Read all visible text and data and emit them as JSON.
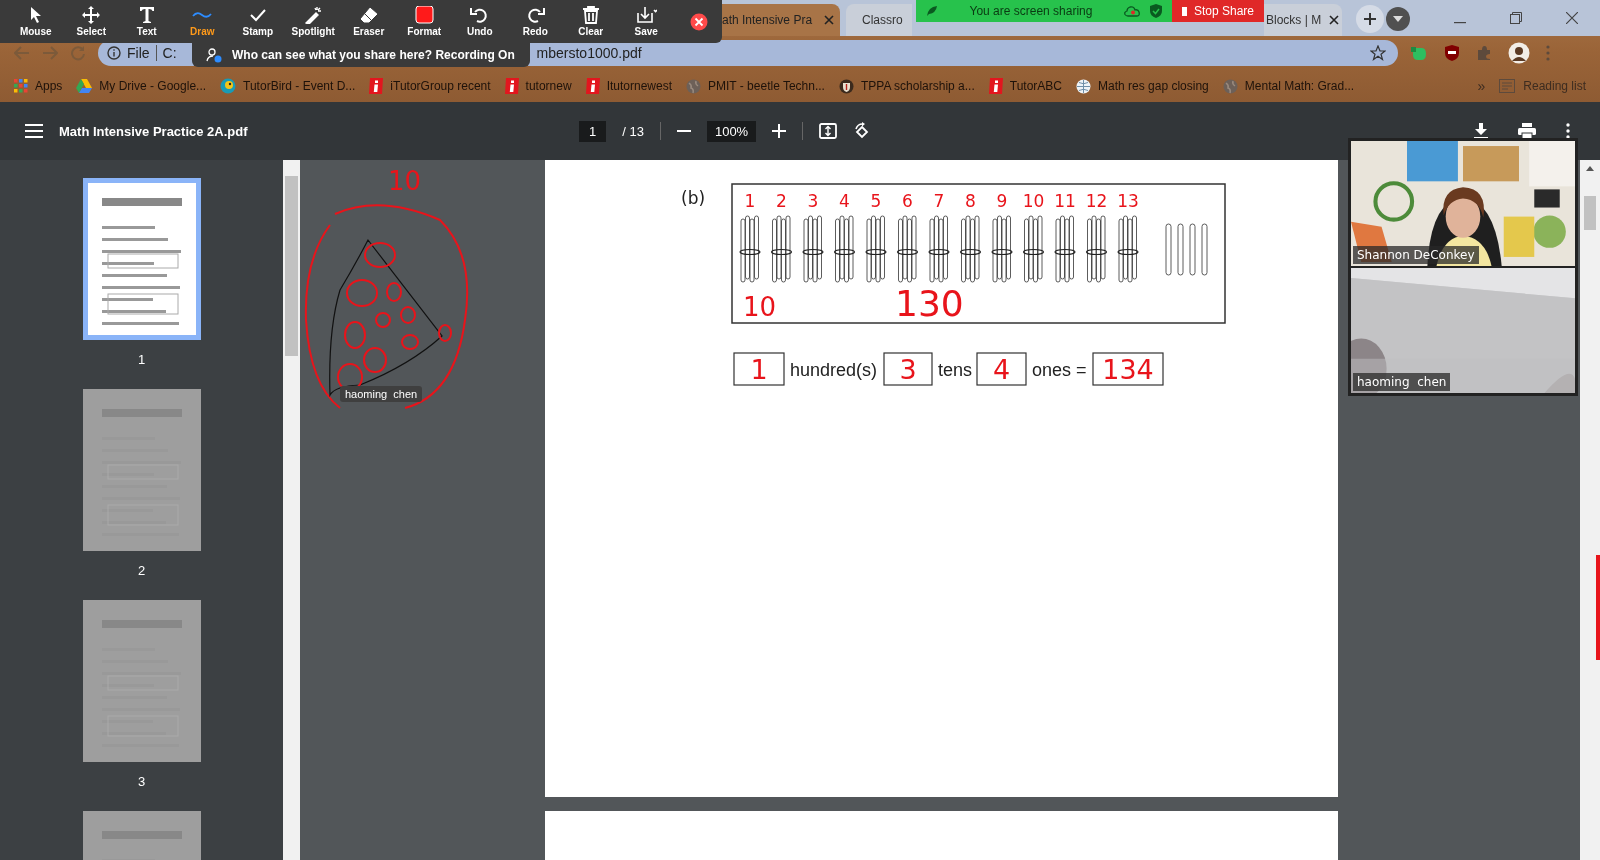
{
  "zoom_toolbar": {
    "tools": [
      {
        "label": "Mouse",
        "kind": "mouse",
        "selected": false
      },
      {
        "label": "Select",
        "kind": "select",
        "selected": false
      },
      {
        "label": "Text",
        "kind": "text",
        "selected": false
      },
      {
        "label": "Draw",
        "kind": "draw",
        "selected": true
      },
      {
        "label": "Stamp",
        "kind": "stamp",
        "selected": false
      },
      {
        "label": "Spotlight",
        "kind": "spotlight",
        "selected": false
      },
      {
        "label": "Eraser",
        "kind": "eraser",
        "selected": false
      },
      {
        "label": "Format",
        "kind": "format",
        "selected": false
      },
      {
        "label": "Undo",
        "kind": "undo",
        "selected": false
      },
      {
        "label": "Redo",
        "kind": "redo",
        "selected": false
      },
      {
        "label": "Clear",
        "kind": "clear",
        "selected": false
      },
      {
        "label": "Save",
        "kind": "save",
        "selected": false
      }
    ]
  },
  "share_tooltip": "Who can see what you share here? Recording On",
  "sharing_banner": {
    "text": "You are screen sharing",
    "stop_button": "Stop Share"
  },
  "browser": {
    "tabs": [
      {
        "title": "ath Intensive Pra",
        "selected": true,
        "closable": true
      },
      {
        "title": "Classro",
        "selected": false,
        "closable": false
      },
      {
        "title": "Blocks | M",
        "selected": false,
        "closable": true
      }
    ],
    "address": {
      "scheme": "File",
      "path_start": "C:",
      "path_end": "mbersto1000.pdf"
    },
    "bookmarks": [
      {
        "label": "Apps",
        "kind": "apps"
      },
      {
        "label": "My Drive - Google...",
        "kind": "drive"
      },
      {
        "label": "TutorBird - Event D...",
        "kind": "bird"
      },
      {
        "label": "iTutorGroup recent",
        "kind": "itutor"
      },
      {
        "label": "tutornew",
        "kind": "itutor"
      },
      {
        "label": "Itutornewest",
        "kind": "itutor"
      },
      {
        "label": "PMIT - beetle Techn...",
        "kind": "globe"
      },
      {
        "label": "TPPA scholarship a...",
        "kind": "crest"
      },
      {
        "label": "TutorABC",
        "kind": "itutor"
      },
      {
        "label": "Math res gap closing",
        "kind": "world"
      },
      {
        "label": "Mental Math: Grad...",
        "kind": "globe"
      }
    ],
    "bookmarks_overflow": "»",
    "reading_list": "Reading list"
  },
  "pdf_viewer": {
    "title": "Math Intensive Practice 2A.pdf",
    "page": "1",
    "page_count": "/ 13",
    "zoom": "100%",
    "thumbnails": [
      {
        "label": "1",
        "selected": true
      },
      {
        "label": "2",
        "selected": false
      },
      {
        "label": "3",
        "selected": false
      },
      {
        "selected": false
      }
    ]
  },
  "worksheet": {
    "part_label": "(b)",
    "bundle_notes": [
      "1",
      "2",
      "3",
      "4",
      "5",
      "6",
      "7",
      "8",
      "9",
      "10",
      "11",
      "12",
      "13"
    ],
    "notes": [
      "10",
      "130"
    ],
    "answers": [
      {
        "answer": "1",
        "label": "hundred(s)"
      },
      {
        "answer": "3",
        "label": "tens"
      },
      {
        "answer": "4",
        "label": "ones ="
      },
      {
        "answer": "134"
      }
    ]
  },
  "annotation": {
    "note": "10",
    "author": "haoming  chen"
  },
  "video_tiles": [
    {
      "name": "Shannon DeConkey",
      "kind": "picture"
    },
    {
      "name": "haoming  chen",
      "kind": "picture"
    }
  ]
}
